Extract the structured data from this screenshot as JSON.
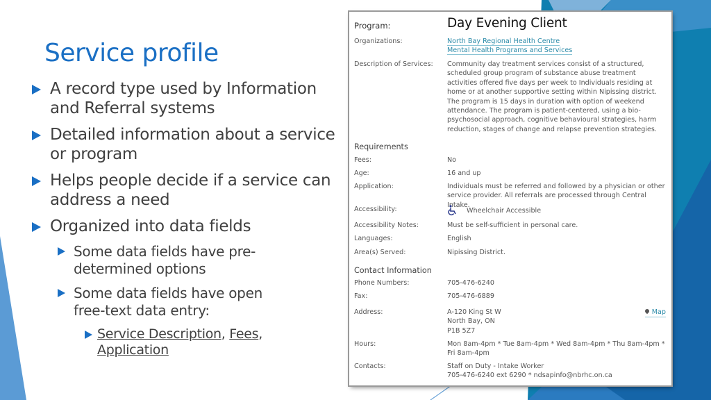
{
  "slide": {
    "title": "Service profile",
    "bullets": [
      {
        "level": 1,
        "text": "A record type used by Information and Referral systems"
      },
      {
        "level": 1,
        "text": "Detailed information about a service or program"
      },
      {
        "level": 1,
        "text": "Helps people decide if a service can address a need"
      },
      {
        "level": 1,
        "text": "Organized into data fields"
      },
      {
        "level": 2,
        "text": "Some data fields have pre-determined options"
      },
      {
        "level": 2,
        "text": "Some data fields have open free-text data entry:"
      }
    ],
    "sub_links": {
      "link1": "Service Description",
      "sep1": ", ",
      "link2": "Fees",
      "sep2": ",",
      "link3": "Application"
    },
    "accent_color": "#1a6fc4"
  },
  "profile": {
    "program_label": "Program:",
    "program_name": "Day Evening Client",
    "organizations_label": "Organizations:",
    "organizations": [
      "North Bay Regional Health Centre",
      "Mental Health Programs and Services"
    ],
    "description_label": "Description of Services:",
    "description": "Community day treatment services consist of a structured, scheduled group program of substance abuse treatment activities offered five days per week to Individuals residing at home or at another supportive setting within Nipissing district. The program is 15 days in duration with option of weekend attendance. The program is patient-centered, using a bio-psychosocial approach, cognitive behavioural strategies, harm reduction, stages of change and relapse prevention strategies.",
    "requirements": {
      "heading": "Requirements",
      "fees_label": "Fees:",
      "fees": "No",
      "age_label": "Age:",
      "age": "16 and up",
      "application_label": "Application:",
      "application": "Individuals must be referred and followed by a physician or other service provider. All referrals are processed through Central Intake.",
      "accessibility_label": "Accessibility:",
      "accessibility_icon": "wheelchair-icon",
      "accessibility": "Wheelchair Accessible",
      "accessibility_notes_label": "Accessibility Notes:",
      "accessibility_notes": "Must be self-sufficient in personal care.",
      "languages_label": "Languages:",
      "languages": "English",
      "areas_label": "Area(s) Served:",
      "areas": "Nipissing District."
    },
    "contact": {
      "heading": "Contact Information",
      "phone_label": "Phone Numbers:",
      "phone": "705-476-6240",
      "fax_label": "Fax:",
      "fax": "705-476-6889",
      "address_label": "Address:",
      "address_lines": [
        "A-120 King St W",
        "North Bay, ON",
        "P1B 5Z7"
      ],
      "map_label": "Map",
      "hours_label": "Hours:",
      "hours": "Mon 8am-4pm * Tue 8am-4pm * Wed 8am-4pm * Thu 8am-4pm * Fri 8am-4pm",
      "contacts_label": "Contacts:",
      "contacts_lines": [
        "Staff on Duty - Intake Worker",
        "705-476-6240 ext 6290 * ndsapinfo@nbrhc.on.ca"
      ]
    },
    "link_color": "#2a8aa8"
  }
}
